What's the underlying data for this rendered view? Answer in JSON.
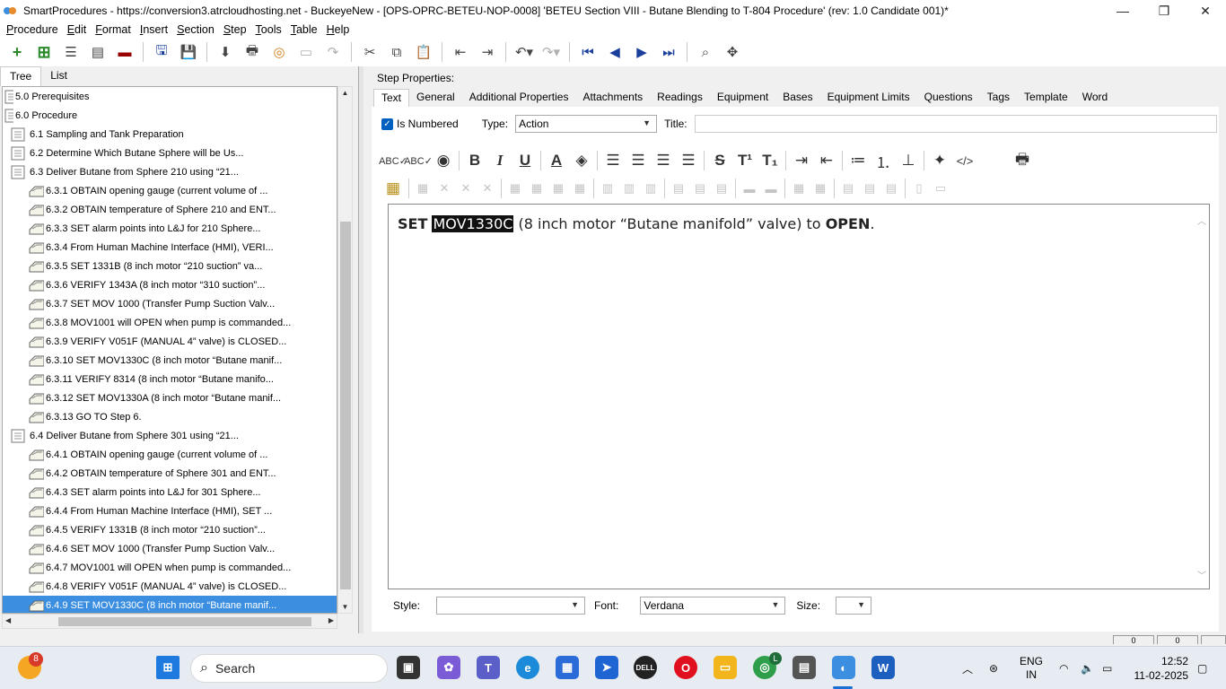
{
  "window": {
    "title": "SmartProcedures - https://conversion3.atrcloudhosting.net - BuckeyeNew - [OPS-OPRC-BETEU-NOP-0008] 'BETEU Section VIII - Butane Blending to T-804 Procedure' (rev: 1.0 Candidate 001)*",
    "minimize": "—",
    "restore": "❐",
    "close": "✕"
  },
  "menu": [
    {
      "label": "Procedure"
    },
    {
      "label": "Edit"
    },
    {
      "label": "Format"
    },
    {
      "label": "Insert"
    },
    {
      "label": "Section"
    },
    {
      "label": "Step"
    },
    {
      "label": "Tools"
    },
    {
      "label": "Table"
    },
    {
      "label": "Help"
    }
  ],
  "left_tabs": {
    "tree": "Tree",
    "list": "List"
  },
  "tree_items": [
    {
      "label": "5.0 Prerequisites",
      "level": 0,
      "kind": "section"
    },
    {
      "label": "6.0 Procedure",
      "level": 0,
      "kind": "section"
    },
    {
      "label": "6.1 Sampling and Tank Preparation",
      "level": 1,
      "kind": "section"
    },
    {
      "label": "6.2 Determine Which Butane Sphere will be Us...",
      "level": 1,
      "kind": "section"
    },
    {
      "label": "6.3 Deliver Butane from Sphere 210 using “21...",
      "level": 1,
      "kind": "section"
    },
    {
      "label": "6.3.1 OBTAIN opening gauge (current volume of ...",
      "level": 2,
      "kind": "step"
    },
    {
      "label": "6.3.2 OBTAIN temperature of Sphere 210 and ENT...",
      "level": 2,
      "kind": "step"
    },
    {
      "label": "6.3.3 SET alarm points into L&J for 210 Sphere...",
      "level": 2,
      "kind": "step"
    },
    {
      "label": "6.3.4 From Human Machine Interface (HMI), VERI...",
      "level": 2,
      "kind": "step"
    },
    {
      "label": "6.3.5 SET 1331B (8 inch motor “210 suction” va...",
      "level": 2,
      "kind": "step"
    },
    {
      "label": "6.3.6 VERIFY 1343A (8 inch motor “310 suction”...",
      "level": 2,
      "kind": "step"
    },
    {
      "label": "6.3.7 SET MOV 1000 (Transfer Pump Suction Valv...",
      "level": 2,
      "kind": "step"
    },
    {
      "label": "6.3.8 MOV1001 will OPEN when pump is commanded...",
      "level": 2,
      "kind": "step"
    },
    {
      "label": "6.3.9 VERIFY V051F (MANUAL 4” valve) is CLOSED...",
      "level": 2,
      "kind": "step"
    },
    {
      "label": "6.3.10 SET MOV1330C (8 inch motor “Butane manif...",
      "level": 2,
      "kind": "step"
    },
    {
      "label": "6.3.11 VERIFY 8314 (8 inch motor “Butane manifo...",
      "level": 2,
      "kind": "step"
    },
    {
      "label": "6.3.12 SET MOV1330A (8 inch motor “Butane manif...",
      "level": 2,
      "kind": "step"
    },
    {
      "label": "6.3.13 GO TO Step 6.",
      "level": 2,
      "kind": "step"
    },
    {
      "label": "6.4 Deliver Butane from Sphere 301 using “21...",
      "level": 1,
      "kind": "section"
    },
    {
      "label": "6.4.1 OBTAIN opening gauge (current volume of ...",
      "level": 2,
      "kind": "step"
    },
    {
      "label": "6.4.2 OBTAIN temperature of Sphere 301 and ENT...",
      "level": 2,
      "kind": "step"
    },
    {
      "label": "6.4.3 SET alarm points into L&J for 301 Sphere...",
      "level": 2,
      "kind": "step"
    },
    {
      "label": "6.4.4 From Human Machine Interface (HMI), SET ...",
      "level": 2,
      "kind": "step"
    },
    {
      "label": "6.4.5 VERIFY 1331B (8 inch motor “210 suction”...",
      "level": 2,
      "kind": "step"
    },
    {
      "label": "6.4.6 SET MOV 1000 (Transfer Pump Suction Valv...",
      "level": 2,
      "kind": "step"
    },
    {
      "label": "6.4.7 MOV1001 will OPEN when pump is commanded...",
      "level": 2,
      "kind": "step"
    },
    {
      "label": "6.4.8 VERIFY V051F (MANUAL 4” valve) is CLOSED...",
      "level": 2,
      "kind": "step"
    },
    {
      "label": "6.4.9 SET MOV1330C (8 inch motor “Butane manif...",
      "level": 2,
      "kind": "step",
      "selected": true
    }
  ],
  "step_properties": {
    "heading": "Step Properties:",
    "tabs": [
      "Text",
      "General",
      "Additional Properties",
      "Attachments",
      "Readings",
      "Equipment",
      "Bases",
      "Equipment Limits",
      "Questions",
      "Tags",
      "Template",
      "Word"
    ],
    "is_numbered_label": "Is Numbered",
    "type_label": "Type:",
    "type_value": "Action",
    "title_label": "Title:",
    "title_value": ""
  },
  "editor": {
    "word_set": "SET",
    "word_mov": "MOV1330C",
    "middle": "(8 inch motor “Butane manifold” valve) to",
    "word_open": "OPEN",
    "end": "."
  },
  "bottom_format": {
    "style_label": "Style:",
    "style_value": "",
    "font_label": "Font:",
    "font_value": "Verdana",
    "size_label": "Size:",
    "size_value": ""
  },
  "status_segments": [
    "0",
    "0"
  ],
  "taskbar": {
    "search_label": "Search",
    "notification_count": "8",
    "language": "ENG",
    "region": "IN",
    "time": "12:52",
    "date": "11-02-2025",
    "chrome_badge": "L"
  },
  "colors": {
    "selection": "#3c8fe0",
    "accent": "#0060c0",
    "nav_blue": "#1a3e9c",
    "add_green": "#2a8a2a"
  }
}
